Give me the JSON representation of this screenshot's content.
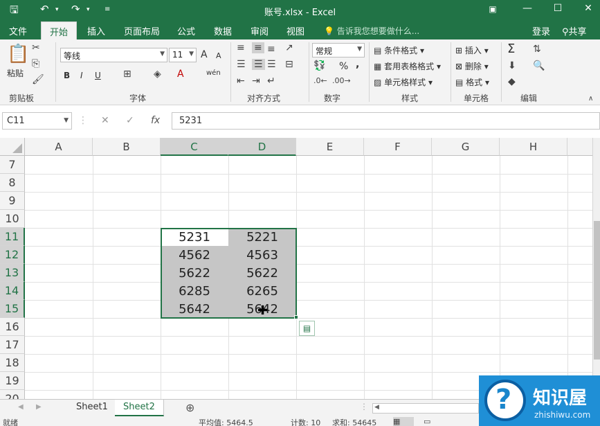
{
  "app": {
    "title": "账号.xlsx - Excel"
  },
  "quick_access": {
    "save_icon": "save-icon",
    "undo_icon": "undo-icon",
    "redo_icon": "redo-icon",
    "customize_icon": "chevron-down-icon"
  },
  "window_controls": {
    "ribbon_display": "▣",
    "minimize": "—",
    "restore": "☐",
    "close": "✕"
  },
  "menu": {
    "tabs": [
      {
        "label": "文件"
      },
      {
        "label": "开始"
      },
      {
        "label": "插入"
      },
      {
        "label": "页面布局"
      },
      {
        "label": "公式"
      },
      {
        "label": "数据"
      },
      {
        "label": "审阅"
      },
      {
        "label": "视图"
      }
    ],
    "active_tab": "开始",
    "tell_me": "告诉我您想要做什么...",
    "login": "登录",
    "share": "共享"
  },
  "ribbon": {
    "clipboard": {
      "paste": "粘贴",
      "group": "剪贴板"
    },
    "font": {
      "name": "等线",
      "size": "11",
      "group": "字体",
      "bold": "B",
      "italic": "I",
      "underline": "U",
      "grow": "A",
      "shrink": "A",
      "wen": "wén"
    },
    "alignment": {
      "group": "对齐方式"
    },
    "number": {
      "format": "常规",
      "group": "数字",
      "percent": "%",
      "comma": ","
    },
    "styles": {
      "conditional": "条件格式",
      "table": "套用表格格式",
      "cell": "单元格样式",
      "group": "样式"
    },
    "cells": {
      "insert": "插入",
      "delete": "删除",
      "format": "格式",
      "group": "单元格"
    },
    "editing": {
      "sum": "Σ",
      "group": "编辑"
    }
  },
  "formula_bar": {
    "name_box": "C11",
    "value": "5231"
  },
  "columns": [
    "A",
    "B",
    "C",
    "D",
    "E",
    "F",
    "G",
    "H"
  ],
  "rows": [
    "7",
    "8",
    "9",
    "10",
    "11",
    "12",
    "13",
    "14",
    "15",
    "16",
    "17",
    "18",
    "19",
    "20"
  ],
  "cells": {
    "c11": "5231",
    "d11": "5221",
    "c12": "4562",
    "d12": "4563",
    "c13": "5622",
    "d13": "5622",
    "c14": "6285",
    "d14": "6265",
    "c15": "5642",
    "d15": "5642"
  },
  "sheets": [
    "Sheet1",
    "Sheet2"
  ],
  "active_sheet": "Sheet2",
  "status": {
    "ready": "就绪",
    "average": "平均值: 5464.5",
    "count": "计数: 10",
    "sum": "求和: 54645"
  },
  "watermark": {
    "title": "知识屋",
    "url": "zhishiwu.com"
  }
}
